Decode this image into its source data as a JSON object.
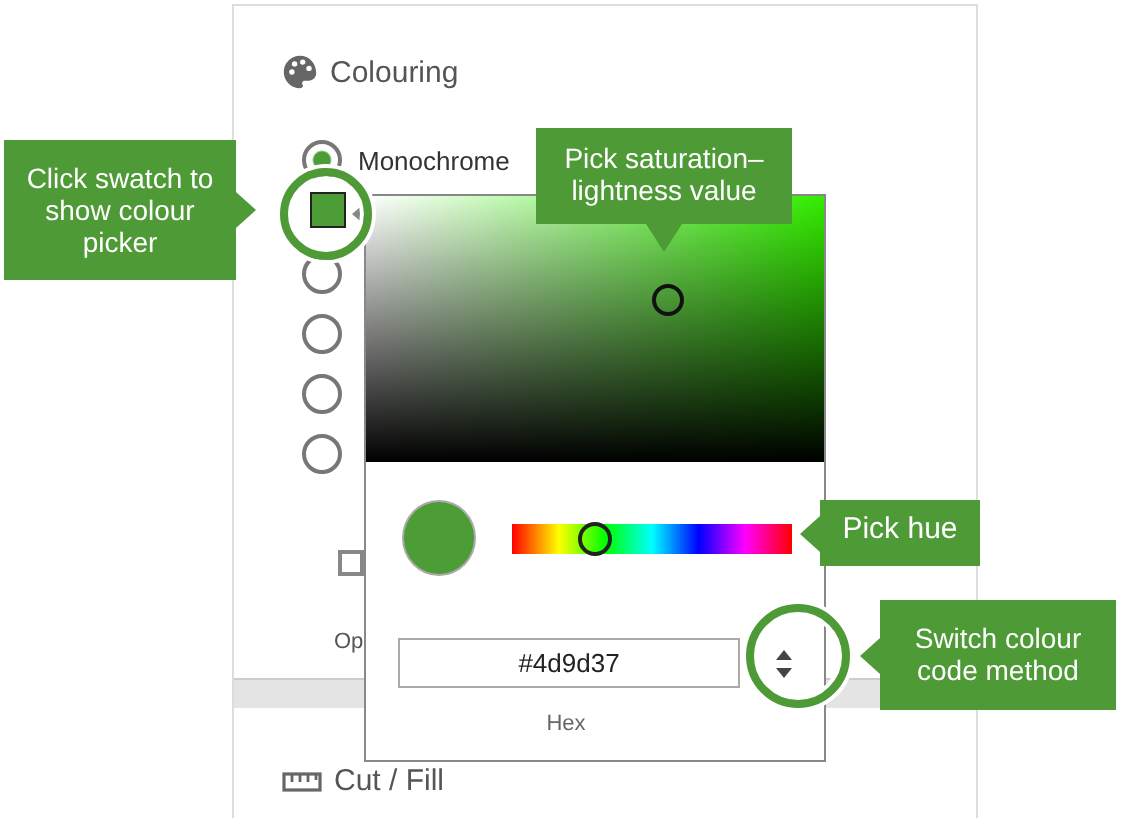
{
  "panel": {
    "heading": "Colouring",
    "options": [
      {
        "label": "Monochrome",
        "selected": true
      },
      {
        "selected": false
      },
      {
        "selected": false
      },
      {
        "selected": false
      },
      {
        "selected": false
      }
    ],
    "checkbox": {
      "checked": false
    },
    "option_text": "Op",
    "next_section": "Cut / Fill"
  },
  "picker": {
    "hue": {
      "level": 0.29
    },
    "hex": "#4d9d37",
    "format": "Hex"
  },
  "callouts": [
    {
      "text": "Click swatch to show colour picker",
      "kind": "right"
    },
    {
      "text": "Pick saturation–lightness value",
      "kind": "down"
    },
    {
      "text": "Pick hue",
      "kind": "left"
    },
    {
      "text": "Switch colour code method",
      "kind": "left"
    }
  ]
}
